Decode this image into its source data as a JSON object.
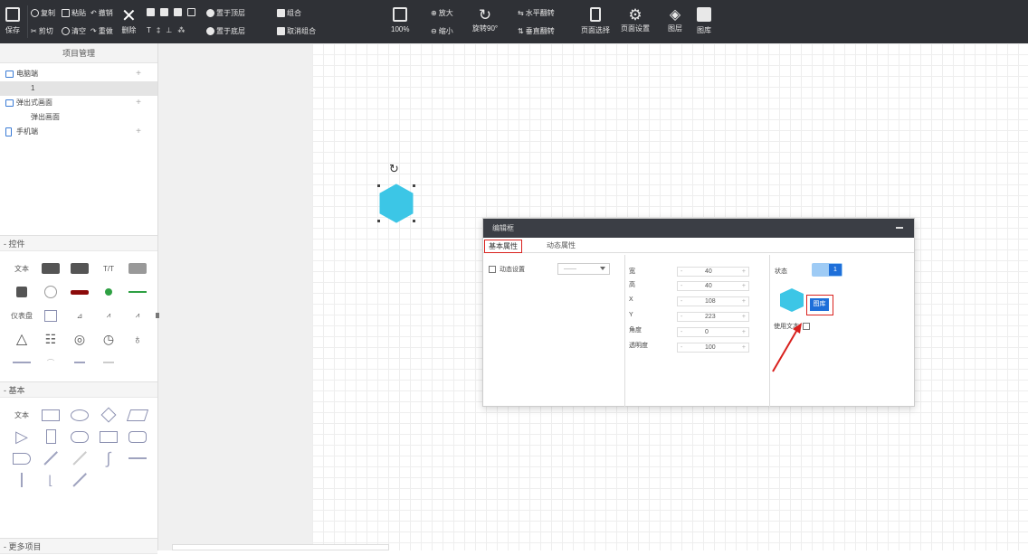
{
  "toolbar": {
    "save": "保存",
    "copy": "复制",
    "cut": "剪切",
    "paste": "粘贴",
    "clear": "清空",
    "undo": "撤销",
    "redo": "重做",
    "delete": "删除",
    "bring_front": "置于顶层",
    "send_back": "置于底层",
    "group": "组合",
    "ungroup": "取消组合",
    "zoom_pct": "100%",
    "zoom_in": "放大",
    "zoom_out": "缩小",
    "rotate": "旋转90°",
    "flip_h": "水平翻转",
    "flip_v": "垂直翻转",
    "page_select": "页面选择",
    "page_settings": "页面设置",
    "layer": "图层",
    "image": "图库"
  },
  "project": {
    "title": "项目管理",
    "items": [
      {
        "label": "电脑端",
        "children": [
          "1"
        ]
      },
      {
        "label": "弹出式画面",
        "children": [
          "弹出画面"
        ]
      },
      {
        "label": "手机端",
        "children": []
      }
    ]
  },
  "sections": {
    "controls": "控件",
    "basic": "基本",
    "more": "更多项目"
  },
  "controls_labels": {
    "text": "文本",
    "t": "T/T",
    "gauge": "仪表盘"
  },
  "dialog": {
    "title": "编辑框",
    "tab_basic": "基本属性",
    "tab_dynamic": "动态属性",
    "checkbox_label": "动态设置",
    "select_placeholder": "——",
    "props": [
      {
        "label": "宽",
        "value": "40"
      },
      {
        "label": "高",
        "value": "40"
      },
      {
        "label": "X",
        "value": "108"
      },
      {
        "label": "Y",
        "value": "223"
      },
      {
        "label": "角度",
        "value": "0"
      },
      {
        "label": "透明度",
        "value": "100"
      }
    ],
    "state_label": "状态",
    "state_value": "1",
    "icon_button": "图库",
    "use_text": "使用文本"
  }
}
